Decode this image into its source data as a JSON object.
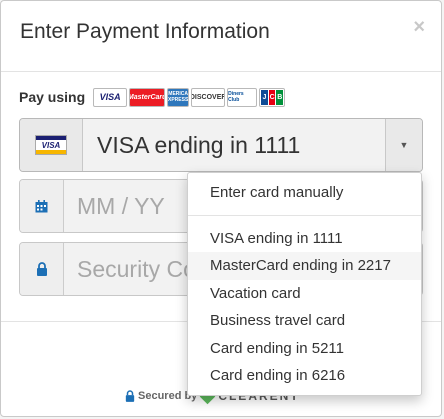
{
  "modal": {
    "title": "Enter Payment Information",
    "close_label": "×"
  },
  "pay_using": {
    "label": "Pay using",
    "logos": [
      {
        "name": "visa",
        "text": "VISA"
      },
      {
        "name": "mastercard",
        "text": "MasterCard"
      },
      {
        "name": "amex",
        "text": "AMERICAN EXPRESS"
      },
      {
        "name": "discover",
        "text": "DISCOVER"
      },
      {
        "name": "diners",
        "text": "Diners Club"
      },
      {
        "name": "jcb",
        "text": "JCB"
      }
    ]
  },
  "card_select": {
    "badge_text": "VISA",
    "selected": "VISA ending in 1111",
    "arrow": "▼"
  },
  "expiry": {
    "placeholder": "MM / YY",
    "icon": "calendar-icon"
  },
  "security": {
    "placeholder": "Security Code",
    "icon": "lock-icon"
  },
  "footer": {
    "secured_label": "Secured by",
    "brand": "CLEARENT"
  },
  "dropdown": {
    "manual": "Enter card manually",
    "options": [
      "VISA ending in 1111",
      "MasterCard ending in 2217",
      "Vacation card",
      "Business travel card",
      "Card ending in 5211",
      "Card ending in 6216"
    ],
    "highlighted_index": 1
  },
  "colors": {
    "visa_blue": "#1a1f71",
    "visa_gold": "#f7b600",
    "mastercard_red": "#ec1c24",
    "amex_blue": "#2e77bc",
    "lock_blue": "#1c6fb5",
    "brand_green": "#5cb85c"
  }
}
